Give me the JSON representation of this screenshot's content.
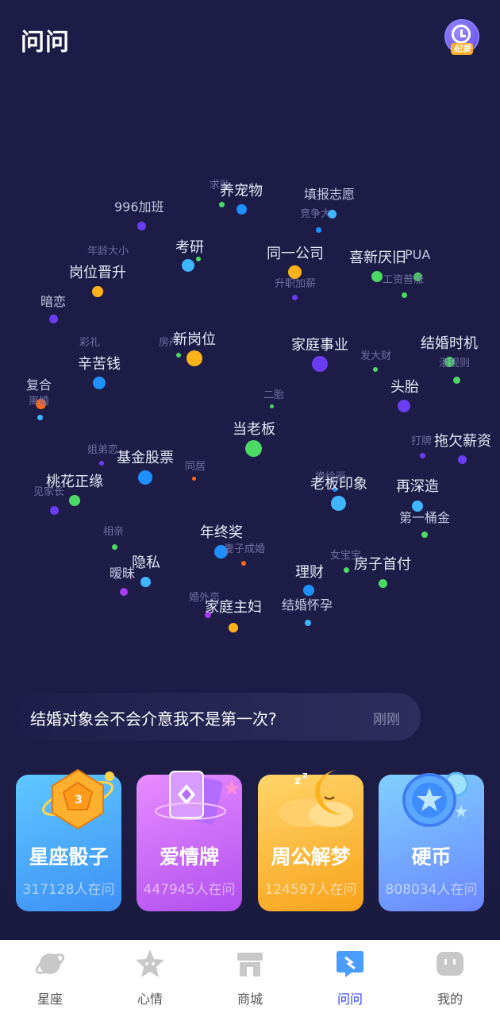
{
  "header": {
    "title": "问问",
    "record_label": "纪录"
  },
  "tags": [
    {
      "t": "求助",
      "c": "sm"
    },
    {
      "t": "养宠物",
      "c": "lg"
    },
    {
      "t": "填报志愿",
      "c": "md"
    },
    {
      "t": "996加班",
      "c": "md"
    },
    {
      "t": "竞争大",
      "c": "sm"
    },
    {
      "t": "年龄大小",
      "c": "sm"
    },
    {
      "t": "考研",
      "c": "lg"
    },
    {
      "t": "同一公司",
      "c": "lg"
    },
    {
      "t": "喜新厌旧",
      "c": "lg"
    },
    {
      "t": "PUA",
      "c": "md"
    },
    {
      "t": "岗位晋升",
      "c": "lg"
    },
    {
      "t": "升职加薪",
      "c": "sm"
    },
    {
      "t": "工资普涨",
      "c": "sm"
    },
    {
      "t": "暗恋",
      "c": "md"
    },
    {
      "t": "彩礼",
      "c": "sm"
    },
    {
      "t": "房产",
      "c": "sm"
    },
    {
      "t": "新岗位",
      "c": "lg"
    },
    {
      "t": "家庭事业",
      "c": "lg"
    },
    {
      "t": "发大财",
      "c": "sm"
    },
    {
      "t": "结婚时机",
      "c": "lg"
    },
    {
      "t": "辛苦钱",
      "c": "lg"
    },
    {
      "t": "潜规则",
      "c": "sm"
    },
    {
      "t": "复合",
      "c": "md"
    },
    {
      "t": "离婚",
      "c": "sm"
    },
    {
      "t": "二胎",
      "c": "sm"
    },
    {
      "t": "头胎",
      "c": "lg"
    },
    {
      "t": "当老板",
      "c": "lg"
    },
    {
      "t": "打牌",
      "c": "sm"
    },
    {
      "t": "拖欠薪资",
      "c": "lg"
    },
    {
      "t": "姐弟恋",
      "c": "sm"
    },
    {
      "t": "基金股票",
      "c": "lg"
    },
    {
      "t": "同居",
      "c": "sm"
    },
    {
      "t": "桃花正缘",
      "c": "lg"
    },
    {
      "t": "见家长",
      "c": "sm"
    },
    {
      "t": "换绘画",
      "c": "sm"
    },
    {
      "t": "老板印象",
      "c": "lg"
    },
    {
      "t": "再深造",
      "c": "lg"
    },
    {
      "t": "第一桶金",
      "c": "md"
    },
    {
      "t": "相亲",
      "c": "sm"
    },
    {
      "t": "年终奖",
      "c": "lg"
    },
    {
      "t": "妻子成婚",
      "c": "sm"
    },
    {
      "t": "隐私",
      "c": "lg"
    },
    {
      "t": "女宝宝",
      "c": "sm"
    },
    {
      "t": "房子首付",
      "c": "lg"
    },
    {
      "t": "暧昧",
      "c": "md"
    },
    {
      "t": "理财",
      "c": "lg"
    },
    {
      "t": "婚外恋",
      "c": "sm"
    },
    {
      "t": "家庭主妇",
      "c": "lg"
    },
    {
      "t": "结婚怀孕",
      "c": "md"
    }
  ],
  "question": {
    "text": "结婚对象会不会介意我不是第一次?",
    "time": "刚刚"
  },
  "cards": [
    {
      "title": "星座骰子",
      "count": "317128人在问",
      "color": "#4aa8ff"
    },
    {
      "title": "爱情牌",
      "count": "447945人在问",
      "color": "#c45cf2"
    },
    {
      "title": "周公解梦",
      "count": "124597人在问",
      "color": "#ffb62e"
    },
    {
      "title": "硬币",
      "count": "808034人在问",
      "color": "#5b86ff"
    }
  ],
  "tabs": [
    {
      "label": "星座",
      "icon": "planet-icon"
    },
    {
      "label": "心情",
      "icon": "star-face-icon"
    },
    {
      "label": "商城",
      "icon": "store-icon"
    },
    {
      "label": "问问",
      "icon": "chat-icon",
      "active": true
    },
    {
      "label": "我的",
      "icon": "profile-icon"
    }
  ]
}
